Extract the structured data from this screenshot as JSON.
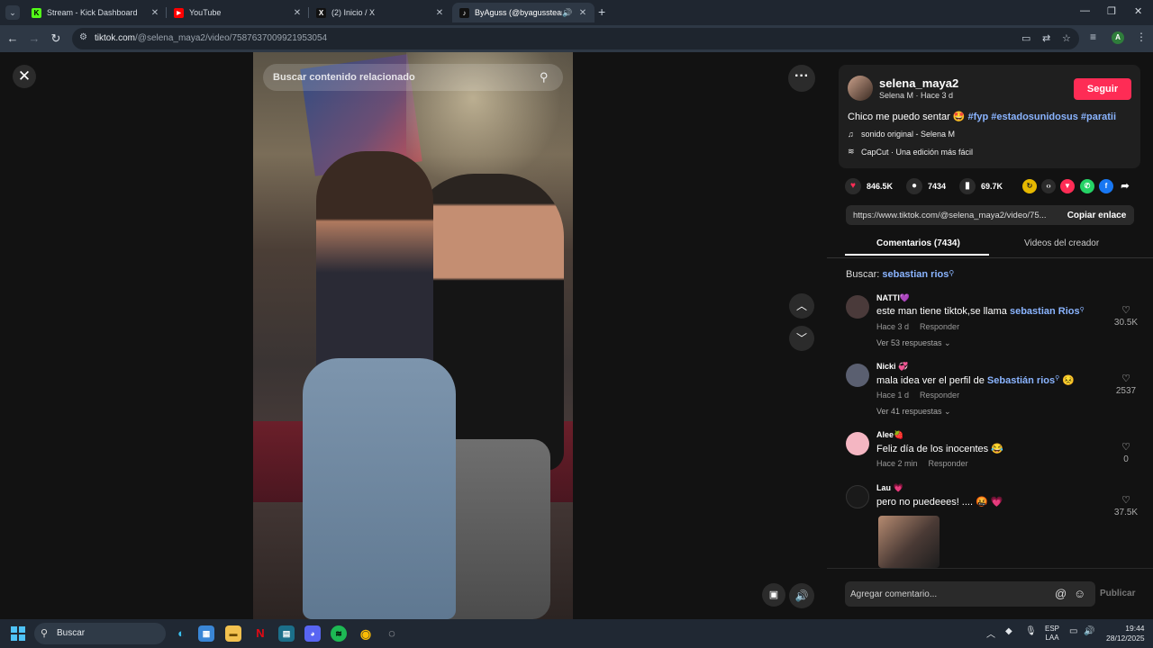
{
  "browser": {
    "tabs": [
      {
        "title": "Stream - Kick Dashboard",
        "favicon": "kick-icon",
        "color": "#53fc18",
        "glyph": "K"
      },
      {
        "title": "YouTube",
        "favicon": "youtube-icon",
        "color": "#ff0000",
        "glyph": "▶"
      },
      {
        "title": "(2) Inicio / X",
        "favicon": "x-icon",
        "color": "#000000",
        "glyph": "X"
      },
      {
        "title": "ByAguss (@byagussteam) |",
        "favicon": "tiktok-icon",
        "color": "#000000",
        "glyph": "♪"
      }
    ],
    "url_host": "tiktok.com",
    "url_path": "/@selena_maya2/video/7587637009921953054"
  },
  "player": {
    "search_placeholder": "Buscar contenido relacionado"
  },
  "post": {
    "username": "selena_maya2",
    "meta": "Selena M · Hace 3 d",
    "follow_label": "Seguir",
    "caption_text": "Chico me puedo sentar 🤩 ",
    "hashtags": [
      "#fyp",
      "#estadosunidosus",
      "#paratii"
    ],
    "sound": "sonido original - Selena M",
    "capcut": "CapCut · Una edición más fácil",
    "likes": "846.5K",
    "comments": "7434",
    "saves": "69.7K",
    "link": "https://www.tiktok.com/@selena_maya2/video/75...",
    "copy_label": "Copiar enlace",
    "accent_color": "#fe2c55"
  },
  "panel_tabs": {
    "comments": "Comentarios (7434)",
    "creator_videos": "Videos del creador"
  },
  "search_hint": {
    "prefix": "Buscar: ",
    "keyword": "sebastian rios"
  },
  "comments": [
    {
      "user": "NATTI💜",
      "text": "este man tiene tiktok,se llama ",
      "mention": "sebastian Rios",
      "suffix": "",
      "time": "Hace 3 d",
      "reply": "Responder",
      "more": "Ver 53 respuestas ⌄",
      "likes": "30.5K",
      "avatar_color": "#4a3a3a"
    },
    {
      "user": "Nicki 💞",
      "text": "mala idea ver el perfil de ",
      "mention": "Sebastián rios",
      "suffix": " 😣",
      "time": "Hace 1 d",
      "reply": "Responder",
      "more": "Ver 41 respuestas ⌄",
      "likes": "2537",
      "avatar_color": "#5a5f70"
    },
    {
      "user": "Alee🍓",
      "text": "Feliz día de los inocentes 😂",
      "mention": "",
      "suffix": "",
      "time": "Hace 2 min",
      "reply": "Responder",
      "more": "",
      "likes": "0",
      "avatar_color": "#f4b6c2"
    },
    {
      "user": "Lau 💗",
      "text": "pero no puedeees! .... 🤬 💗",
      "mention": "",
      "suffix": "",
      "time": "",
      "reply": "",
      "more": "",
      "likes": "37.5K",
      "avatar_color": "#1a1a1a"
    }
  ],
  "composer": {
    "placeholder": "Agregar comentario...",
    "publish": "Publicar"
  },
  "taskbar": {
    "search": "Buscar",
    "lang_top": "ESP",
    "lang_bottom": "LAA",
    "time": "19:44",
    "date": "28/12/2025"
  }
}
